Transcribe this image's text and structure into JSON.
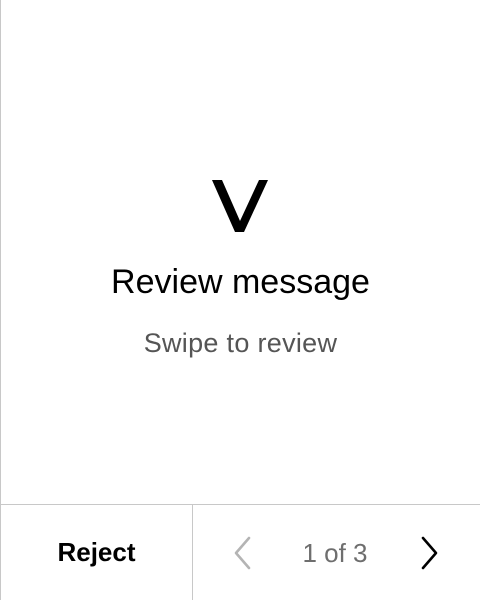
{
  "message": {
    "title": "Review message",
    "subtitle": "Swipe to review",
    "logo_icon": "v-logo-icon"
  },
  "footer": {
    "reject_label": "Reject",
    "pagination": {
      "text": "1 of 3",
      "current": 1,
      "total": 3,
      "prev_icon": "chevron-left-icon",
      "next_icon": "chevron-right-icon",
      "prev_enabled": false,
      "next_enabled": true
    }
  },
  "colors": {
    "text_primary": "#000000",
    "text_secondary": "#555555",
    "divider": "#c8c8c8",
    "disabled_icon": "#b4b4b4"
  }
}
